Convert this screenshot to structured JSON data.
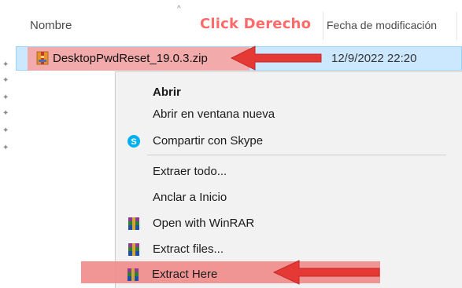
{
  "header": {
    "columns": [
      {
        "label": "Nombre"
      },
      {
        "label": "Fecha de modificación"
      }
    ]
  },
  "annotation": {
    "callout": "Click Derecho",
    "accent_color": "#ff6b6b"
  },
  "file": {
    "name": "DesktopPwdReset_19.0.3.zip",
    "modified": "12/9/2022 22:20",
    "icon": "winrar-zip-icon"
  },
  "context_menu": {
    "items": [
      {
        "label": "Abrir",
        "bold": true,
        "icon": null
      },
      {
        "label": "Abrir en ventana nueva",
        "bold": false,
        "icon": null
      },
      {
        "label": "Compartir con Skype",
        "bold": false,
        "icon": "skype-icon"
      },
      {
        "label": "Extraer todo...",
        "bold": false,
        "icon": null
      },
      {
        "label": "Anclar a Inicio",
        "bold": false,
        "icon": null
      },
      {
        "label": "Open with WinRAR",
        "bold": false,
        "icon": "winrar-icon"
      },
      {
        "label": "Extract files...",
        "bold": false,
        "icon": "winrar-icon"
      },
      {
        "label": "Extract Here",
        "bold": false,
        "icon": "winrar-icon",
        "highlighted": true
      }
    ]
  },
  "colors": {
    "selection": "#cce8ff",
    "highlight": "#f4a6a6",
    "arrow": "#e53935",
    "menu_bg": "#f2f2f2"
  }
}
